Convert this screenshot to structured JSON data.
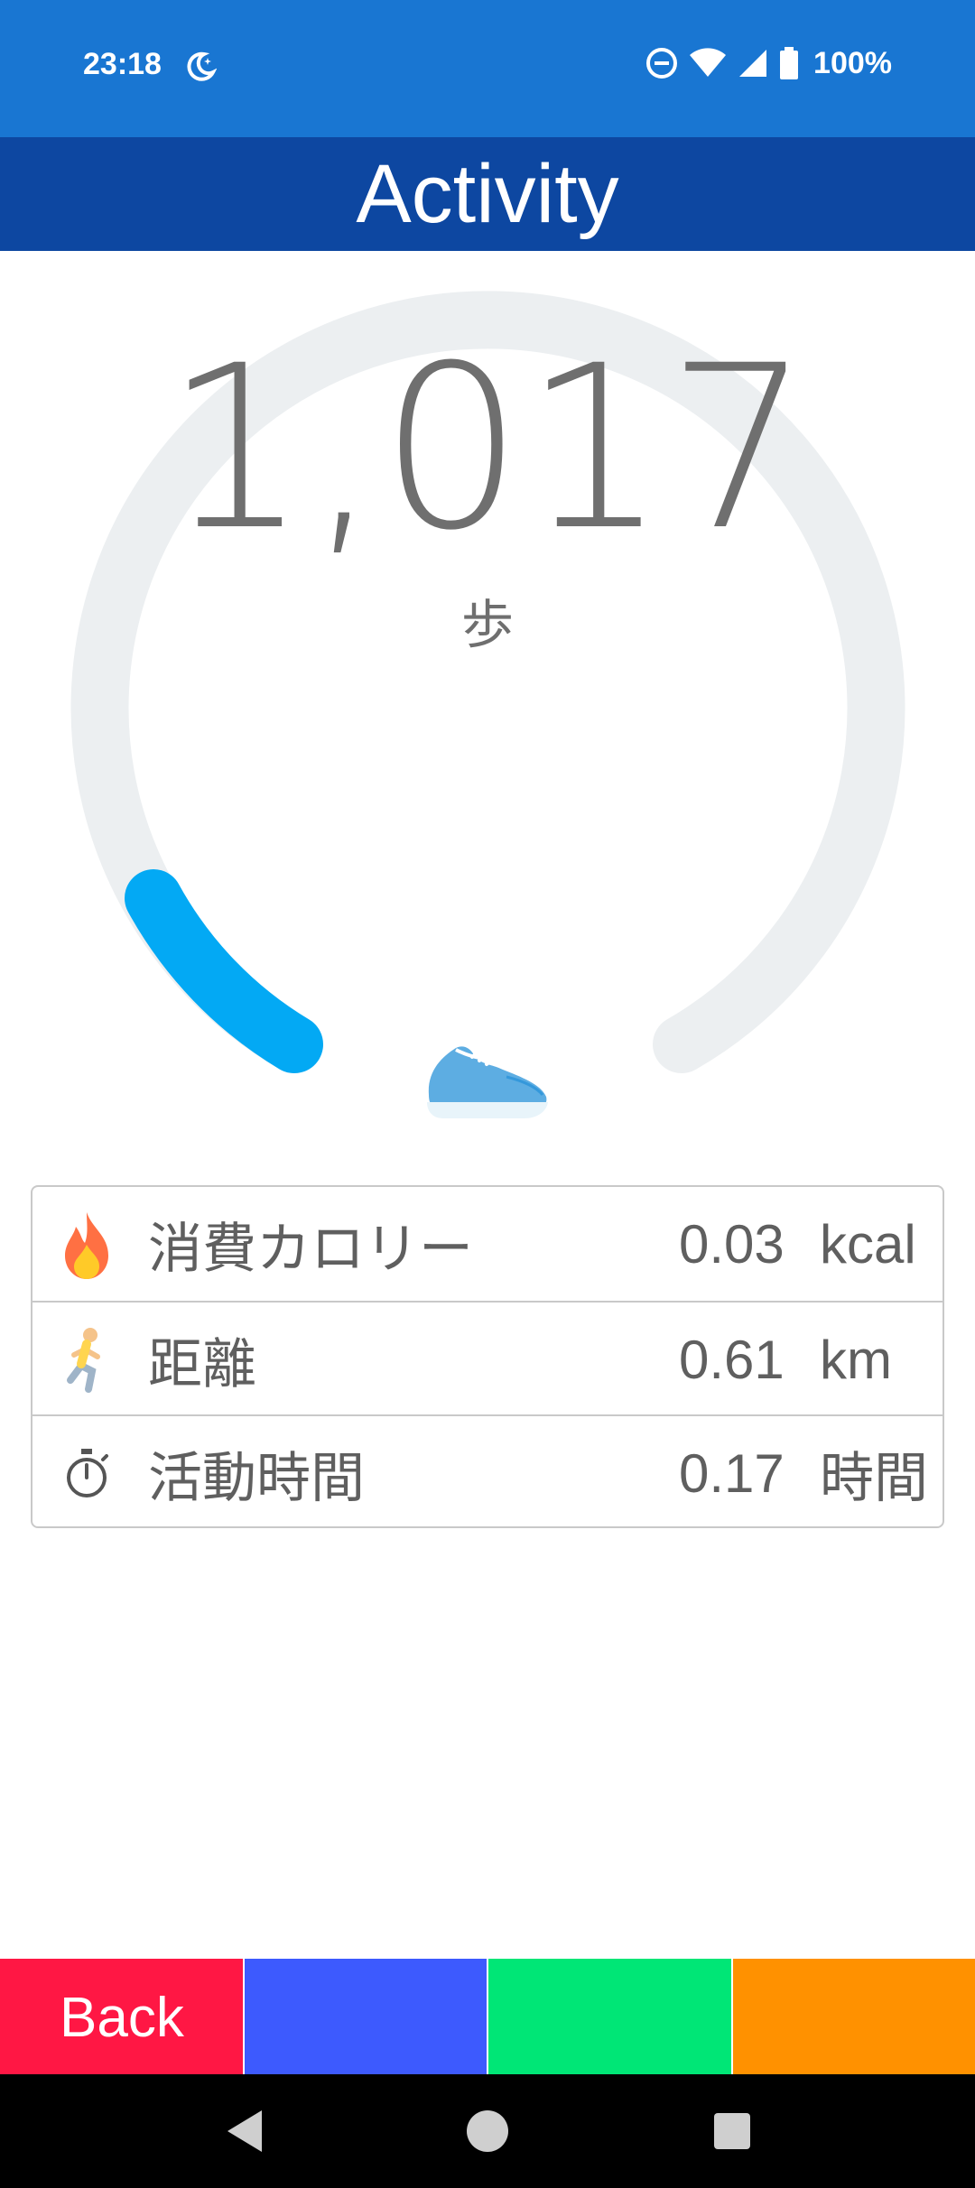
{
  "status_bar": {
    "time": "23:18",
    "battery": "100%",
    "icons": [
      "moon-icon",
      "dnd-icon",
      "wifi-icon",
      "signal-icon",
      "battery-icon"
    ]
  },
  "app_bar": {
    "title": "Activity"
  },
  "gauge": {
    "steps": "1,017",
    "unit": "歩",
    "progress_fraction": 0.1,
    "colors": {
      "track": "#ECEFF1",
      "progress": "#03A9F4"
    }
  },
  "stats": [
    {
      "icon": "fire-icon",
      "label": "消費カロリー",
      "value": "0.03",
      "unit": "kcal"
    },
    {
      "icon": "runner-icon",
      "label": "距離",
      "value": "0.61",
      "unit": "km"
    },
    {
      "icon": "stopwatch-icon",
      "label": "活動時間",
      "value": "0.17",
      "unit": "時間"
    }
  ],
  "bottom_buttons": [
    {
      "label": "Back",
      "color": "#FF1744"
    },
    {
      "label": "",
      "color": "#3D5AFE"
    },
    {
      "label": "",
      "color": "#00E676"
    },
    {
      "label": "",
      "color": "#FF9100"
    }
  ],
  "nav_bar": {
    "icons": [
      "back-icon",
      "home-icon",
      "recents-icon"
    ]
  }
}
